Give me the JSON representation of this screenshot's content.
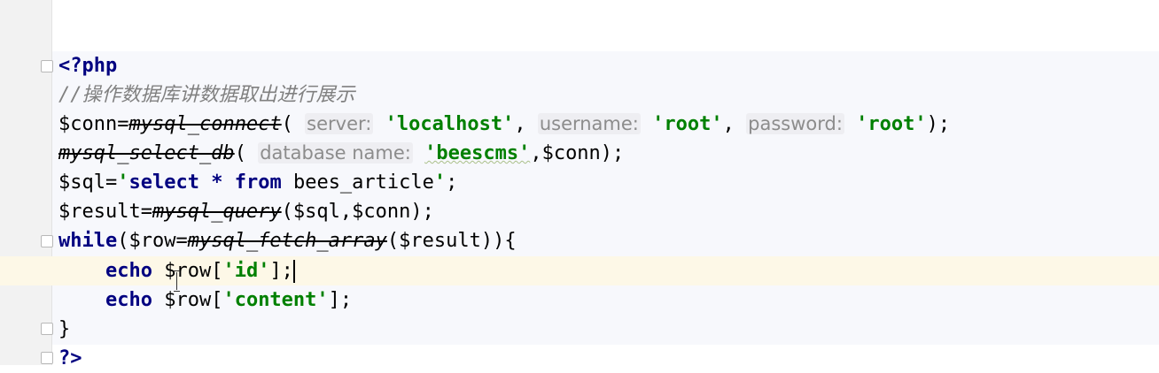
{
  "editor": {
    "language": "php",
    "open_tag": "<?php",
    "comment": "//操作数据库讲数据取出进行展示",
    "conn": {
      "assign": "$conn=",
      "func": "mysql_connect",
      "open": "(",
      "hint_server": "server:",
      "arg_server": "'localhost'",
      "sep1": ",",
      "hint_username": "username:",
      "arg_username": "'root'",
      "sep2": ",",
      "hint_password": "password:",
      "arg_password": "'root'",
      "close": ");"
    },
    "select_db": {
      "func": "mysql_select_db",
      "open": "(",
      "hint_database": "database name:",
      "arg_database": "'beescms'",
      "rest": ",$conn);"
    },
    "sql": {
      "assign": "$sql=",
      "quote_open": "'",
      "kw_select": "select",
      "star": "*",
      "kw_from": "from",
      "table": "bees_article",
      "quote_close": "'",
      "end": ";"
    },
    "result": {
      "assign": "$result=",
      "func": "mysql_query",
      "args": "($sql,$conn);"
    },
    "while_line": {
      "kw": "while",
      "pre": "($row=",
      "func": "mysql_fetch_array",
      "post": "($result)){"
    },
    "echo_id": {
      "kw": "echo",
      "var": "$row[",
      "key": "'id'",
      "end": "];"
    },
    "echo_content": {
      "kw": "echo",
      "var": "$row[",
      "key": "'content'",
      "end": "];"
    },
    "close_brace": "}",
    "close_tag": "?>"
  },
  "colors": {
    "keyword": "#000080",
    "string": "#008000",
    "comment": "#808080",
    "caret_line": "#fdf8e7",
    "php_background": "#f7f8fc"
  }
}
